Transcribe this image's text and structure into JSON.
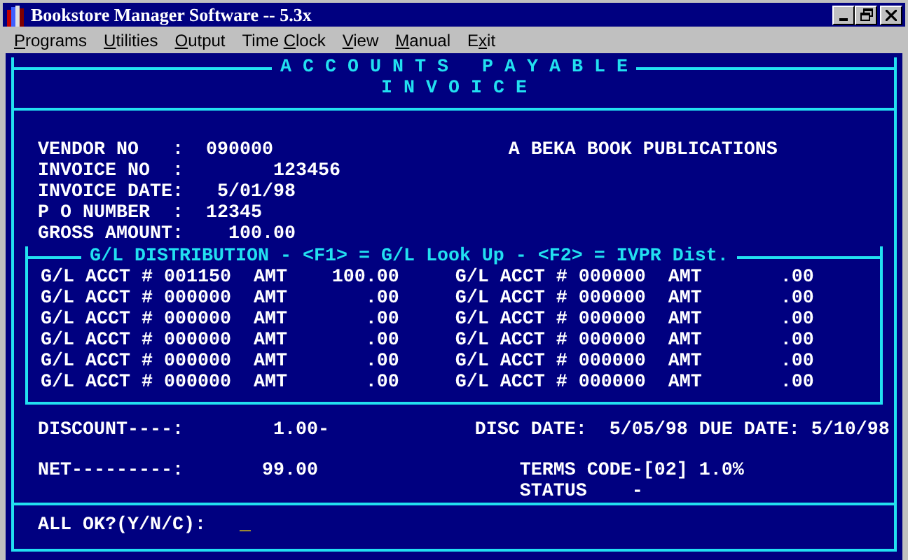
{
  "window": {
    "title": "Bookstore Manager Software -- 5.3x"
  },
  "menu": [
    {
      "key": "P",
      "after": "rograms"
    },
    {
      "key": "U",
      "after": "tilities"
    },
    {
      "key": "O",
      "after": "utput"
    },
    {
      "before": "Time ",
      "key": "C",
      "after": "lock"
    },
    {
      "key": "V",
      "after": "iew"
    },
    {
      "key": "M",
      "after": "anual"
    },
    {
      "before": "E",
      "key": "x",
      "after": "it"
    }
  ],
  "screen": {
    "title": "A C C O U N T S   P A Y A B L E",
    "subtitle": "I N V O I C E",
    "fields": [
      {
        "label": "VENDOR NO   :",
        "value": "090000"
      },
      {
        "label": "INVOICE NO  :",
        "value": "123456"
      },
      {
        "label": "INVOICE DATE:",
        "value": "5/01/98"
      },
      {
        "label": "P O NUMBER  :",
        "value": "12345"
      },
      {
        "label": "GROSS AMOUNT:",
        "value": "100.00"
      }
    ],
    "vendor_name": "A BEKA BOOK PUBLICATIONS",
    "distribution": {
      "title": "G/L DISTRIBUTION - <F1> = G/L Look Up - <F2> = IVPR Dist.",
      "rows": [
        [
          {
            "label": "G/L ACCT #",
            "acct": "001150",
            "amt_label": "AMT",
            "amount": "100.00"
          },
          {
            "label": "G/L ACCT #",
            "acct": "000000",
            "amt_label": "AMT",
            "amount": ".00"
          }
        ],
        [
          {
            "label": "G/L ACCT #",
            "acct": "000000",
            "amt_label": "AMT",
            "amount": ".00"
          },
          {
            "label": "G/L ACCT #",
            "acct": "000000",
            "amt_label": "AMT",
            "amount": ".00"
          }
        ],
        [
          {
            "label": "G/L ACCT #",
            "acct": "000000",
            "amt_label": "AMT",
            "amount": ".00"
          },
          {
            "label": "G/L ACCT #",
            "acct": "000000",
            "amt_label": "AMT",
            "amount": ".00"
          }
        ],
        [
          {
            "label": "G/L ACCT #",
            "acct": "000000",
            "amt_label": "AMT",
            "amount": ".00"
          },
          {
            "label": "G/L ACCT #",
            "acct": "000000",
            "amt_label": "AMT",
            "amount": ".00"
          }
        ],
        [
          {
            "label": "G/L ACCT #",
            "acct": "000000",
            "amt_label": "AMT",
            "amount": ".00"
          },
          {
            "label": "G/L ACCT #",
            "acct": "000000",
            "amt_label": "AMT",
            "amount": ".00"
          }
        ],
        [
          {
            "label": "G/L ACCT #",
            "acct": "000000",
            "amt_label": "AMT",
            "amount": ".00"
          },
          {
            "label": "G/L ACCT #",
            "acct": "000000",
            "amt_label": "AMT",
            "amount": ".00"
          }
        ]
      ]
    },
    "discount": {
      "label": "DISCOUNT----:",
      "value": "1.00-"
    },
    "disc_date": {
      "label": "DISC DATE:",
      "value": "5/05/98"
    },
    "due_date": {
      "label": "DUE DATE:",
      "value": "5/10/98"
    },
    "net": {
      "label": "NET---------:",
      "value": "99.00"
    },
    "terms": "TERMS CODE-[02] 1.0%",
    "status": {
      "label": "STATUS",
      "value": "-"
    },
    "prompt": {
      "label": "ALL OK?(Y/N/C):",
      "cursor": "_"
    }
  }
}
